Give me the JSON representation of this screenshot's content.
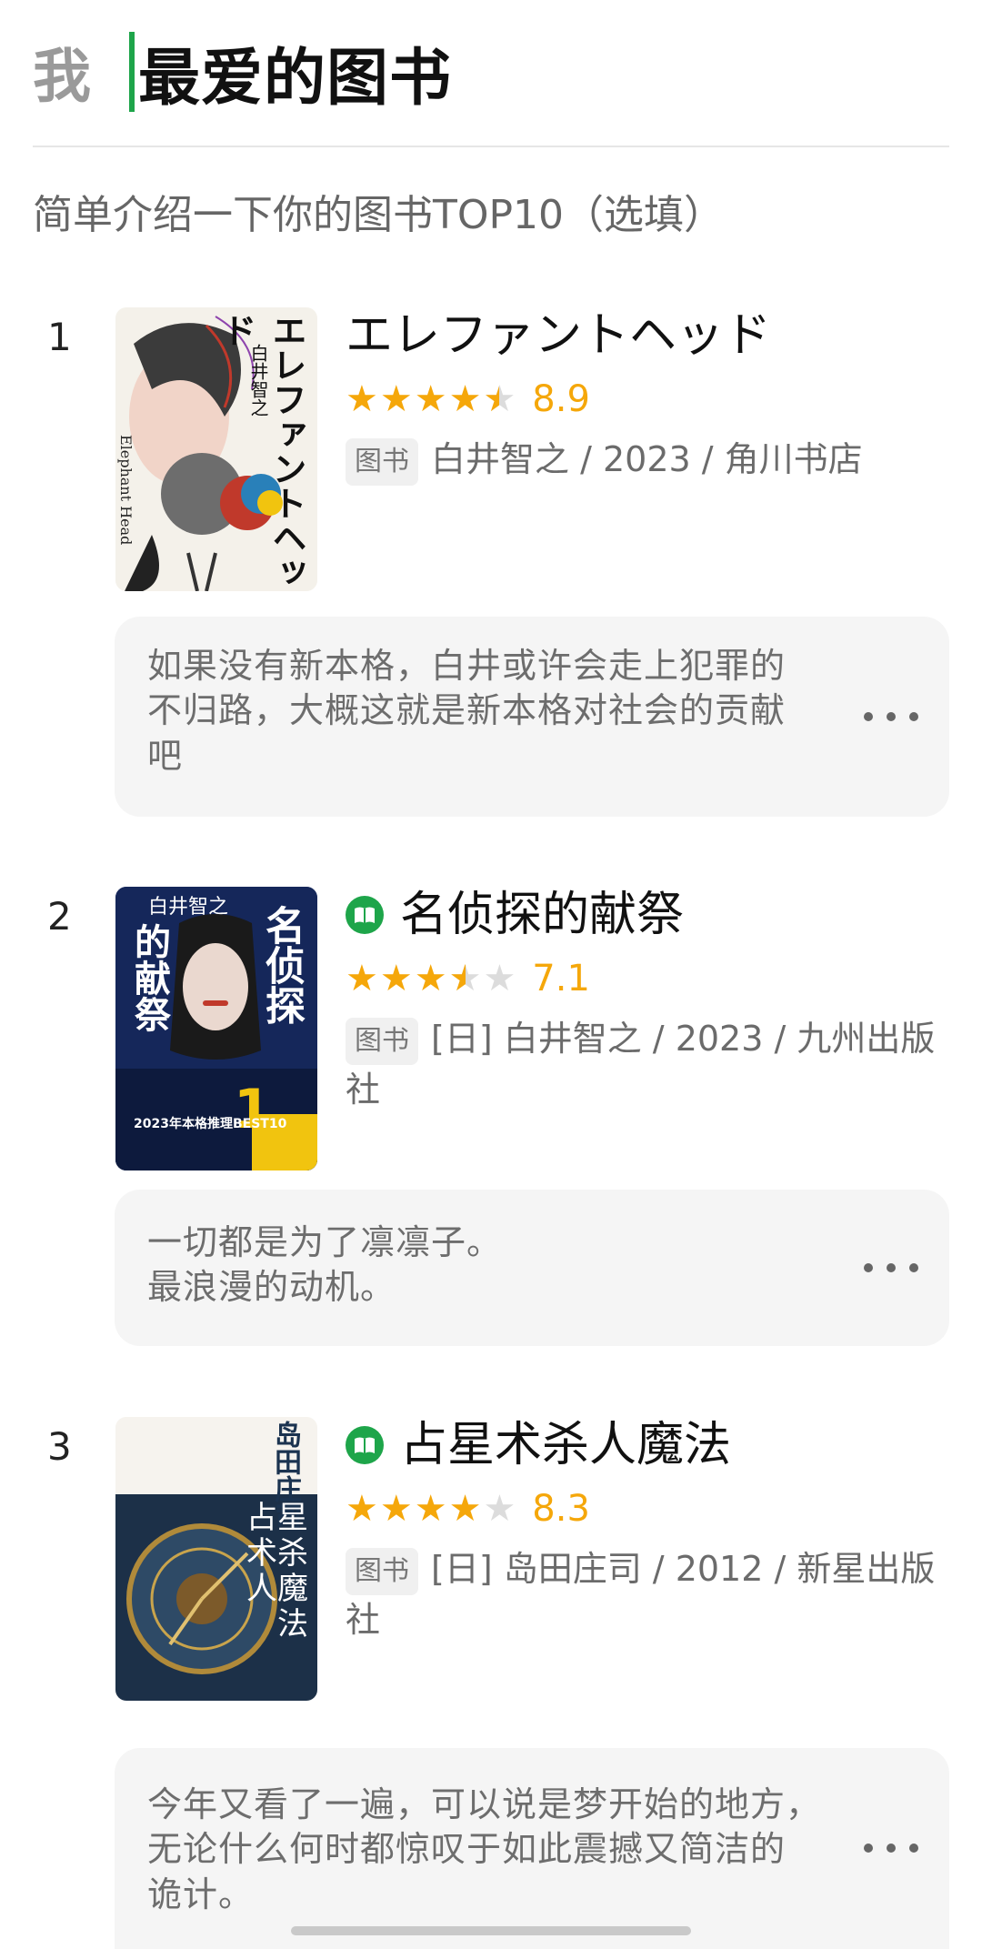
{
  "header": {
    "prefix": "我",
    "title_input": "最爱的图书",
    "intro_placeholder": "简单介绍一下你的图书TOP10（选填）"
  },
  "books": [
    {
      "rank": "1",
      "title": "エレファントヘッド",
      "read": false,
      "rating": 4.5,
      "score": "8.9",
      "tag": "图书",
      "meta": "白井智之 / 2023 / 角川书店",
      "comment": "如果没有新本格，白井或许会走上犯罪的\n不归路，大概这就是新本格对社会的贡献\n吧",
      "cover": {
        "vertical_title": "エレファントヘッド",
        "author": "白井智之",
        "english": "Elephant Head"
      }
    },
    {
      "rank": "2",
      "title": "名侦探的献祭",
      "read": true,
      "rating": 3.5,
      "score": "7.1",
      "tag": "图书",
      "meta": "[日] 白井智之 / 2023 / 九州出版社",
      "comment": "一切都是为了凛凛子。\n最浪漫的动机。",
      "cover": {
        "author": "白井智之",
        "title_a": "名侦探",
        "title_b": "的献祭",
        "banner": "2023年本格推理BEST10"
      }
    },
    {
      "rank": "3",
      "title": "占星术杀人魔法",
      "read": true,
      "rating": 4,
      "score": "8.3",
      "tag": "图书",
      "meta": "[日] 岛田庄司 / 2012 / 新星出版社",
      "comment": "今年又看了一遍，可以说是梦开始的地方，\n无论什么何时都惊叹于如此震撼又简洁的\n诡计。",
      "cover": {
        "author": "岛田庄司",
        "title": "占星术杀人魔法"
      }
    }
  ],
  "colors": {
    "accent": "#1ea54a",
    "star": "#f5a70a"
  }
}
